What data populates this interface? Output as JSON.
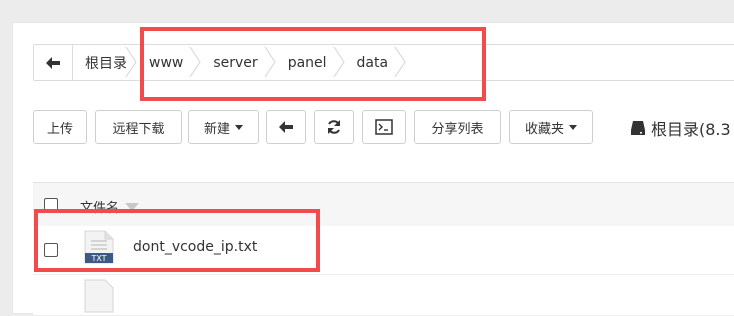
{
  "breadcrumb": {
    "back_icon": "arrow-left-icon",
    "items": [
      "根目录",
      "www",
      "server",
      "panel",
      "data"
    ]
  },
  "toolbar": {
    "upload": "上传",
    "remote_download": "远程下载",
    "new": "新建",
    "back_icon": "arrow-left-icon",
    "refresh_icon": "refresh-icon",
    "terminal_icon": "terminal-icon",
    "share_list": "分享列表",
    "favorites": "收藏夹",
    "disk_label": "根目录(8.3",
    "disk_icon": "hard-drive-icon"
  },
  "file_list": {
    "header_name": "文件名",
    "rows": [
      {
        "name": "dont_vcode_ip.txt",
        "type_label": "TXT"
      }
    ]
  },
  "colors": {
    "highlight": "#f24b4b",
    "panel_bg": "#ffffff",
    "page_bg": "#ececec"
  }
}
